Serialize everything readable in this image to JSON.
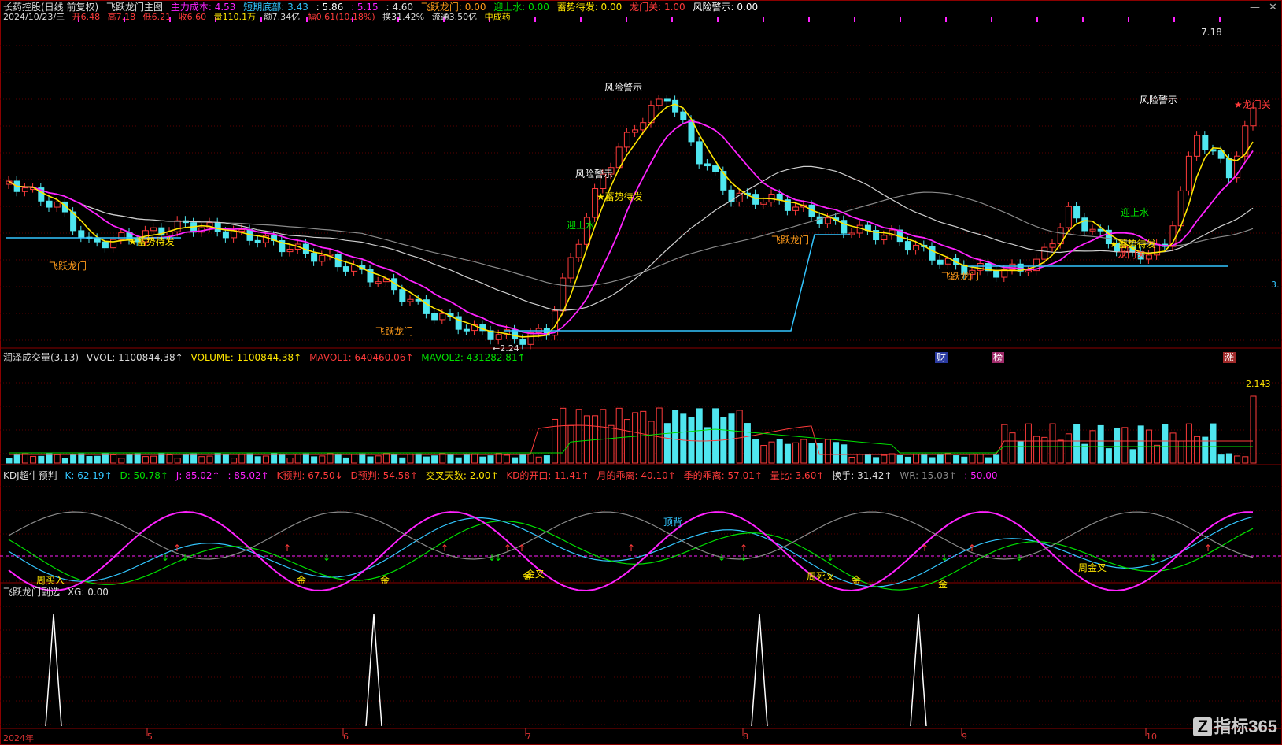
{
  "colors": {
    "up": "#ff3b3b",
    "down": "#4fe6ef",
    "ma_yellow": "#ffe600",
    "ma_magenta": "#ff22ff",
    "ma_white": "#cfcfcf",
    "ma_grey": "#8a8a8a",
    "support": "#33c6ff",
    "grid": "#5a0000",
    "white_accent": "#ffffff",
    "green": "#00e000",
    "orange": "#ff9a1a"
  },
  "header": {
    "stock": "长药控股(日线 前复权)",
    "indicator_name": "飞跃龙门主图",
    "main_cost_label": "主力成本: 4.53",
    "short_bottom_label": "短期底部: 3.43",
    "v1": ": 5.86",
    "v2": ": 5.15",
    "v3": ": 4.60",
    "feiyue_label": "飞跃龙门: 0.00",
    "yingshangshui_label": "迎上水: 0.00",
    "xushi_label": "蓄势待发: 0.00",
    "longmenguan_label": "龙门关: 1.00",
    "risk_label": "风险警示: 0.00",
    "info_date": "2024/10/23/三",
    "info_open": "开6.48",
    "info_high": "高7.18",
    "info_low": "低6.21",
    "info_close": "收6.60",
    "info_vol": "量110.1万",
    "info_amount": "额7.34亿",
    "info_change": "幅0.61(10.18%)",
    "info_turnover": "换31.42%",
    "info_float": "流通3.50亿",
    "info_industry": "中成药"
  },
  "main_chart": {
    "high_label": "7.18",
    "low_label": "←2.24",
    "right_edge_label": "3.",
    "annotations": [
      {
        "text": "飞跃龙门",
        "color": "orange"
      },
      {
        "text": "★蓄势待发",
        "color": "yellow"
      },
      {
        "text": "飞跃龙门",
        "color": "orange"
      },
      {
        "text": "风险警示",
        "color": "white"
      },
      {
        "text": "风险警示",
        "color": "white"
      },
      {
        "text": "迎上水",
        "color": "green"
      },
      {
        "text": "★蓄势待发",
        "color": "yellow"
      },
      {
        "text": "飞跃龙门",
        "color": "orange"
      },
      {
        "text": "飞跃龙门",
        "color": "orange"
      },
      {
        "text": "风险警示",
        "color": "white"
      },
      {
        "text": "迎上水",
        "color": "green"
      },
      {
        "text": "★蓄势待发",
        "color": "yellow"
      },
      {
        "text": "龙门关",
        "color": "red"
      },
      {
        "text": "★龙门关",
        "color": "red"
      }
    ],
    "markers": [
      "财",
      "榜",
      "涨"
    ]
  },
  "volume_panel": {
    "title": "润泽成交量(3,13)",
    "vvol_label": "VVOL: 1100844.38↑",
    "volume_label": "VOLUME: 1100844.38↑",
    "mavol1_label": "MAVOL1: 640460.06↑",
    "mavol2_label": "MAVOL2: 431282.81↑",
    "max_label": "2.143"
  },
  "kdj_panel": {
    "title": "KDJ超牛预判",
    "k_label": "K: 62.19↑",
    "d_label": "D: 50.78↑",
    "j_label": "J: 85.02↑",
    "j2_label": ": 85.02↑",
    "kpre_label": "K预判: 67.50↓",
    "dpre_label": "D预判: 54.58↑",
    "cross_label": "交叉天数: 2.00↑",
    "kd_open_label": "KD的开口: 11.41↑",
    "month_dev_label": "月的乖离: 40.10↑",
    "season_dev_label": "季的乖离: 57.01↑",
    "ratio_label": "量比: 3.60↑",
    "turnover_label": "换手: 31.42↑",
    "wr_label": "WR: 15.03↑",
    "fifty_label": ": 50.00",
    "tags": [
      "周买入",
      "金",
      "金",
      "金",
      "金叉",
      "顶背",
      "周死叉",
      "金",
      "金",
      "周金叉"
    ]
  },
  "sub_panel": {
    "title": "飞跃龙门副选",
    "xg_label": "XG: 0.00"
  },
  "x_axis": {
    "labels": [
      "2024年",
      "5",
      "6",
      "7",
      "8",
      "9",
      "10"
    ]
  },
  "brand": {
    "logo": "Z",
    "text": "指标365"
  }
}
